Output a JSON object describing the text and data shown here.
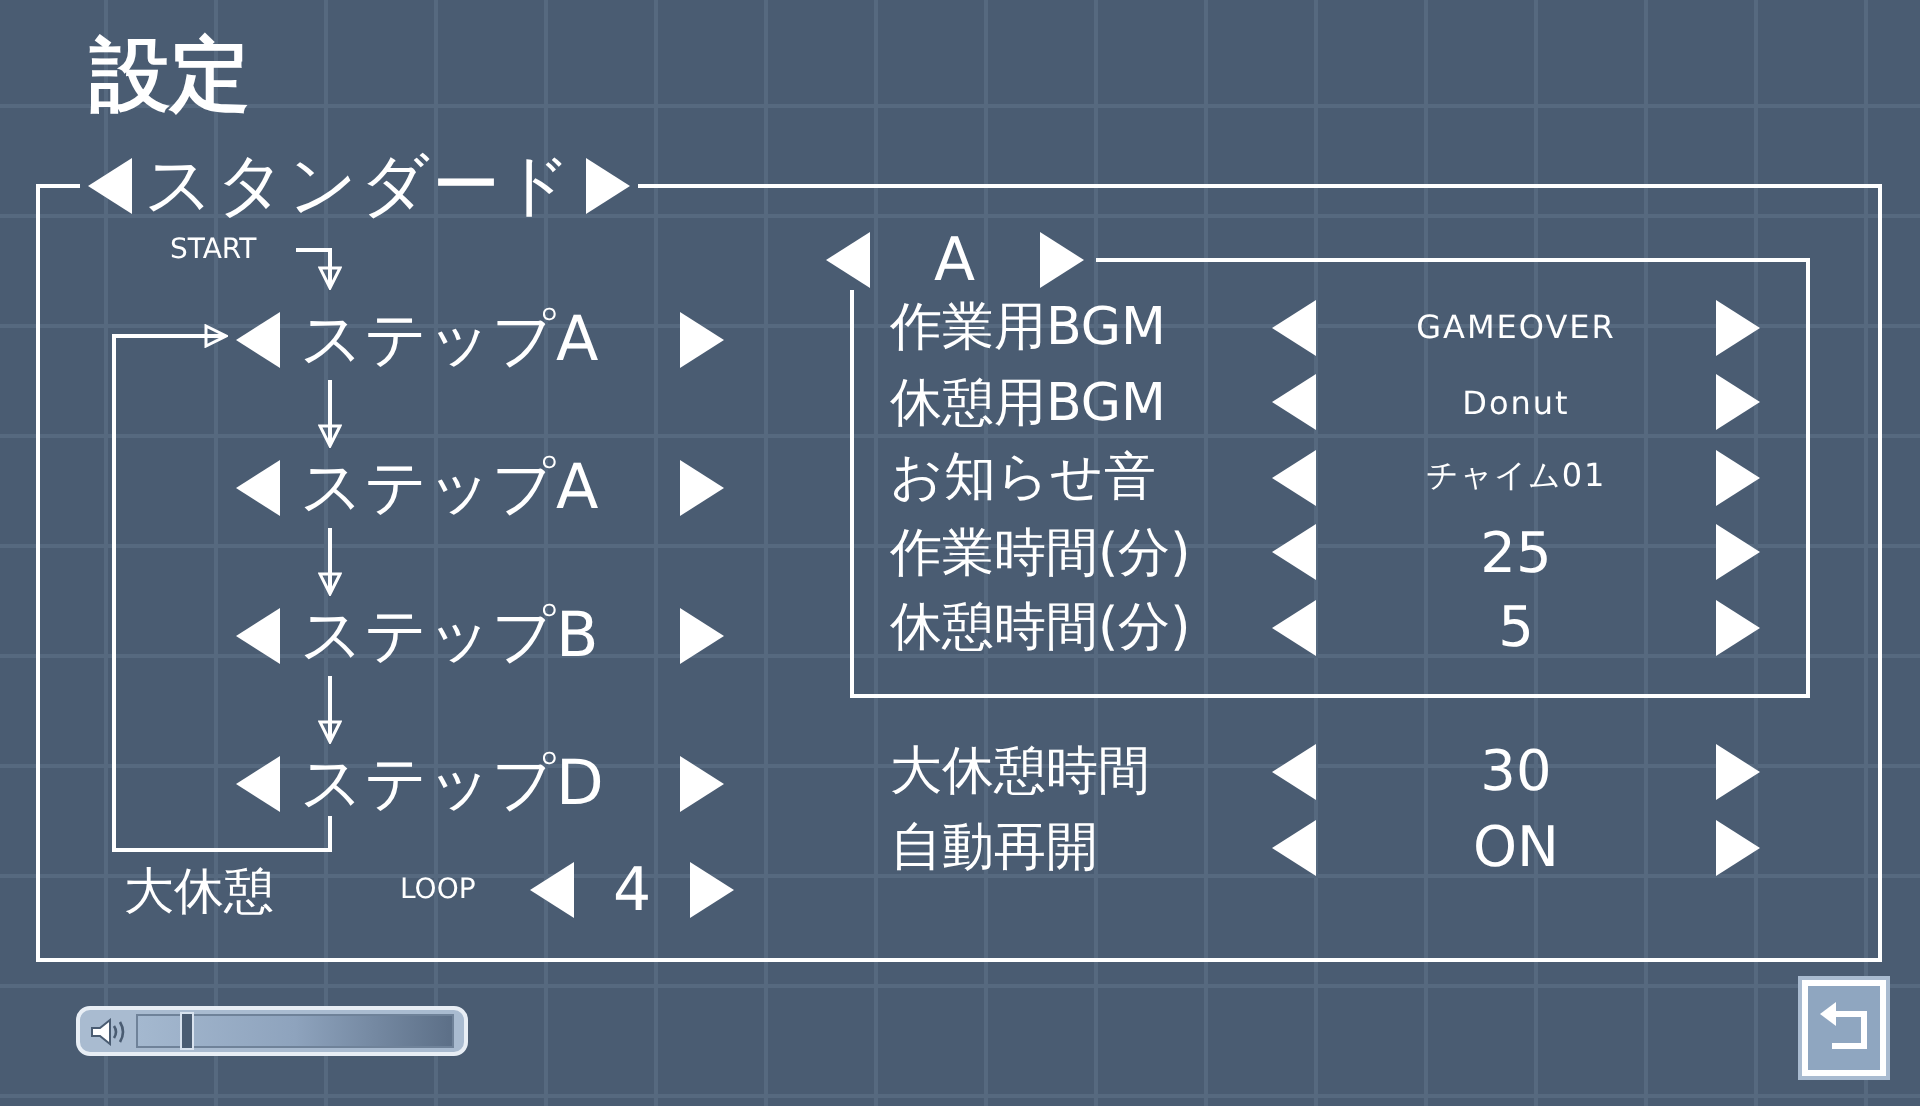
{
  "title": "設定",
  "preset": {
    "label": "スタンダード"
  },
  "flow": {
    "start_label": "START",
    "steps": [
      {
        "label": "ステップA"
      },
      {
        "label": "ステップA"
      },
      {
        "label": "ステップB"
      },
      {
        "label": "ステップD"
      }
    ],
    "long_break_label": "大休憩",
    "loop_label": "LOOP",
    "loop_count": "4"
  },
  "step_settings": {
    "label": "A",
    "rows": [
      {
        "label": "作業用BGM",
        "value": "GAMEOVER",
        "kind": "text"
      },
      {
        "label": "休憩用BGM",
        "value": "Donut",
        "kind": "text"
      },
      {
        "label": "お知らせ音",
        "value": "チャイム01",
        "kind": "text"
      },
      {
        "label": "作業時間(分)",
        "value": "25",
        "kind": "number"
      },
      {
        "label": "休憩時間(分)",
        "value": "5",
        "kind": "number"
      }
    ]
  },
  "global_settings": [
    {
      "label": "大休憩時間",
      "value": "30",
      "kind": "number"
    },
    {
      "label": "自動再開",
      "value": "ON",
      "kind": "number"
    }
  ],
  "volume": {
    "level": 0.15
  }
}
